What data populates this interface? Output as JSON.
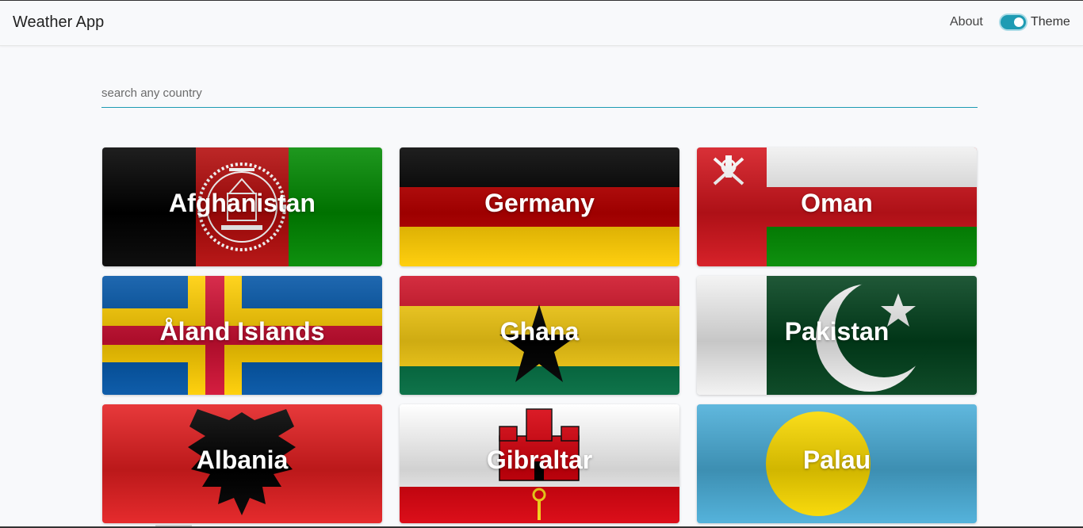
{
  "app": {
    "title": "Weather App"
  },
  "nav": {
    "about_label": "About",
    "theme_label": "Theme",
    "theme_toggle_on": true
  },
  "search": {
    "placeholder": "search any country",
    "value": ""
  },
  "colors": {
    "accent": "#1e9bb3",
    "background": "#f8f9fb"
  },
  "countries": [
    {
      "name": "Afghanistan",
      "flag_icon": "afghanistan-flag"
    },
    {
      "name": "Germany",
      "flag_icon": "germany-flag"
    },
    {
      "name": "Oman",
      "flag_icon": "oman-flag"
    },
    {
      "name": "Åland Islands",
      "flag_icon": "aland-islands-flag"
    },
    {
      "name": "Ghana",
      "flag_icon": "ghana-flag"
    },
    {
      "name": "Pakistan",
      "flag_icon": "pakistan-flag"
    },
    {
      "name": "Albania",
      "flag_icon": "albania-flag"
    },
    {
      "name": "Gibraltar",
      "flag_icon": "gibraltar-flag"
    },
    {
      "name": "Palau",
      "flag_icon": "palau-flag"
    }
  ]
}
